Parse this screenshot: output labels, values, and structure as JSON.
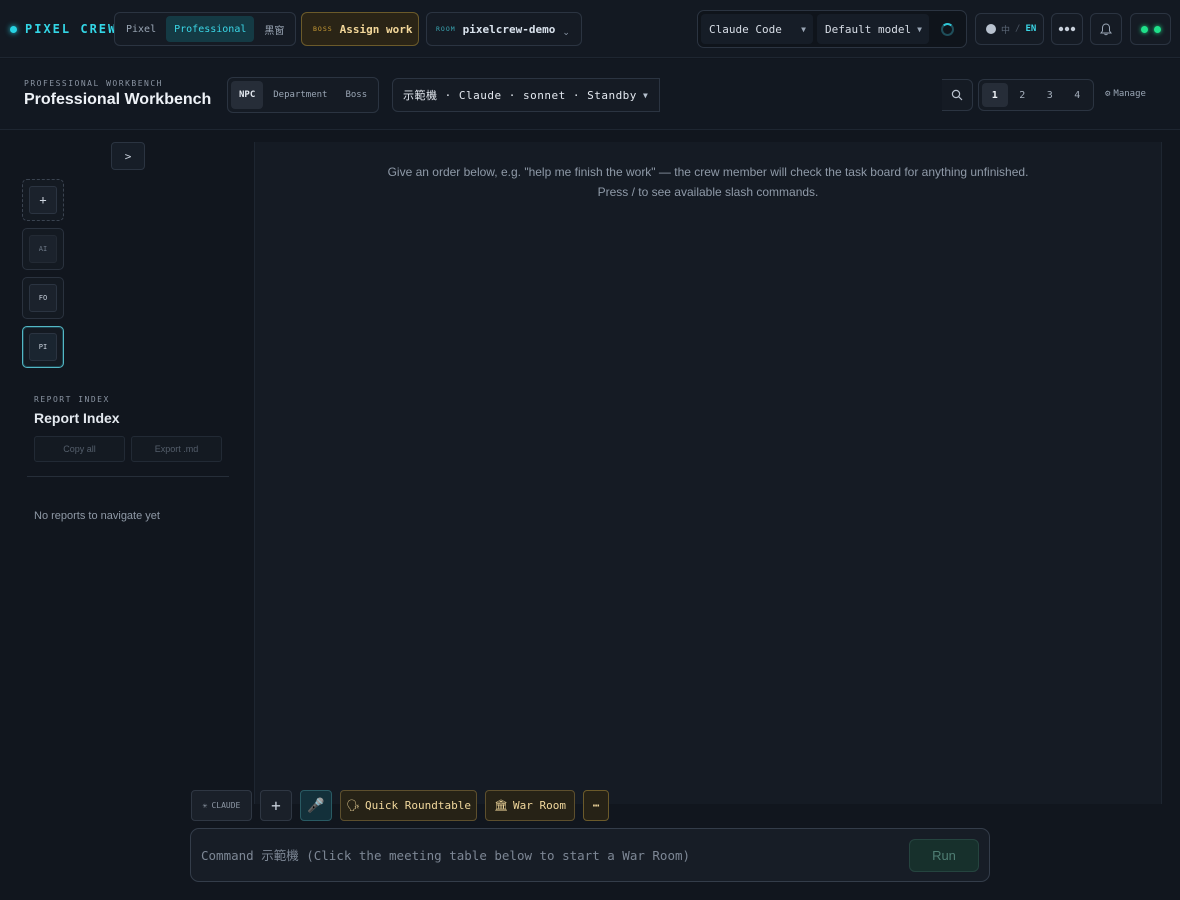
{
  "brand": {
    "name": "PIXEL CREW"
  },
  "modes": [
    {
      "label": "Pixel",
      "active": false
    },
    {
      "label": "Professional",
      "active": true
    },
    {
      "label": "黑窗",
      "active": false
    }
  ],
  "assign": {
    "tag": "BOSS",
    "label": "Assign work"
  },
  "room": {
    "tag": "ROOM",
    "name": "pixelcrew-demo"
  },
  "engine": {
    "provider": "Claude Code",
    "model": "Default model"
  },
  "language": {
    "zh": "中",
    "separator": "/",
    "en": "EN"
  },
  "header": {
    "subtitle": "PROFESSIONAL WORKBENCH",
    "title": "Professional Workbench",
    "views": [
      {
        "label": "NPC",
        "active": true
      },
      {
        "label": "Department",
        "active": false
      },
      {
        "label": "Boss",
        "active": false
      }
    ],
    "agent_selector": "示範機 · Claude · sonnet · Standby",
    "pages": [
      {
        "label": "1",
        "active": true
      },
      {
        "label": "2",
        "active": false
      },
      {
        "label": "3",
        "active": false
      },
      {
        "label": "4",
        "active": false
      }
    ],
    "manage_label": "Manage"
  },
  "sidebar": {
    "collapse_label": ">",
    "agents": [
      {
        "label": "+",
        "kind": "add"
      },
      {
        "label": "AI",
        "kind": "dim"
      },
      {
        "label": "FO",
        "kind": "normal"
      },
      {
        "label": "PI",
        "kind": "selected"
      }
    ],
    "report_index": {
      "subtitle": "REPORT INDEX",
      "title": "Report Index",
      "copy_all": "Copy all",
      "export_md": "Export .md",
      "empty": "No reports to navigate yet"
    }
  },
  "main": {
    "hint_line1": "Give an order below, e.g. \"help me finish the work\" — the crew member will check the task board for anything unfinished.",
    "hint_line2": "Press / to see available slash commands."
  },
  "toolbar": {
    "claude_label": "CLAUDE",
    "plus_label": "+",
    "mic_icon": "🎤",
    "roundtable_icon": "🗣",
    "roundtable_label": "Quick Roundtable",
    "warroom_icon": "🏛",
    "warroom_label": "War Room",
    "more_label": "⋯"
  },
  "command": {
    "placeholder": "Command 示範機 (Click the meeting table below to start a War Room)",
    "run_label": "Run"
  },
  "colors": {
    "accent": "#33d6e6",
    "gold": "#f0d79c",
    "status_green": "#1fe08a",
    "background": "#11161e"
  }
}
